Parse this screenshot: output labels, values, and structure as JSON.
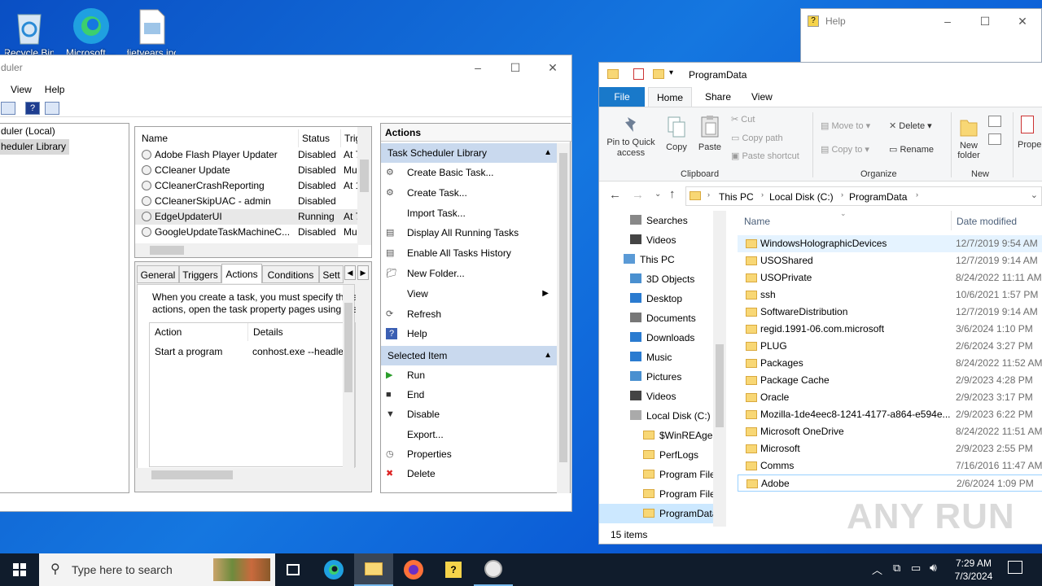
{
  "desktop": {
    "icons": [
      {
        "label": "Recycle Bin"
      },
      {
        "label": "Microsoft ..."
      },
      {
        "label": "dietyears.jpg"
      }
    ]
  },
  "task_scheduler": {
    "title": "duler",
    "menu": [
      "View",
      "Help"
    ],
    "tree": [
      "duler (Local)",
      "heduler Library"
    ],
    "task_list": {
      "columns": [
        "Name",
        "Status",
        "Trig"
      ],
      "rows": [
        {
          "name": "Adobe Flash Player Updater",
          "status": "Disabled",
          "trigger": "At 7"
        },
        {
          "name": "CCleaner Update",
          "status": "Disabled",
          "trigger": "Mu"
        },
        {
          "name": "CCleanerCrashReporting",
          "status": "Disabled",
          "trigger": "At 1"
        },
        {
          "name": "CCleanerSkipUAC - admin",
          "status": "Disabled",
          "trigger": ""
        },
        {
          "name": "EdgeUpdaterUI",
          "status": "Running",
          "trigger": "At 7"
        },
        {
          "name": "GoogleUpdateTaskMachineC...",
          "status": "Disabled",
          "trigger": "Mu"
        }
      ]
    },
    "detail_tabs": [
      "General",
      "Triggers",
      "Actions",
      "Conditions",
      "Sett"
    ],
    "active_tab": "Actions",
    "detail_text_1": "When you create a task, you must specify the ac",
    "detail_text_2": "actions, open the task property pages using the",
    "actions_table": {
      "columns": [
        "Action",
        "Details"
      ],
      "rows": [
        {
          "action": "Start a program",
          "details": "conhost.exe --headless"
        }
      ]
    },
    "actions_pane": {
      "header": "Actions",
      "section1": "Task Scheduler Library",
      "items1": [
        "Create Basic Task...",
        "Create Task...",
        "Import Task...",
        "Display All Running Tasks",
        "Enable All Tasks History",
        "New Folder...",
        "View",
        "Refresh",
        "Help"
      ],
      "section2": "Selected Item",
      "items2": [
        "Run",
        "End",
        "Disable",
        "Export...",
        "Properties",
        "Delete"
      ]
    }
  },
  "help_window": {
    "title": "Help"
  },
  "explorer": {
    "title": "ProgramData",
    "ribbon_tabs": [
      "File",
      "Home",
      "Share",
      "View"
    ],
    "active_tab": "Home",
    "clipboard": {
      "pin": "Pin to Quick access",
      "copy": "Copy",
      "paste": "Paste",
      "cut": "Cut",
      "copy_path": "Copy path",
      "paste_shortcut": "Paste shortcut",
      "group": "Clipboard"
    },
    "organize": {
      "move_to": "Move to",
      "copy_to": "Copy to",
      "delete": "Delete",
      "rename": "Rename",
      "group": "Organize"
    },
    "new": {
      "new_folder": "New folder",
      "group": "New"
    },
    "properties": "Prope",
    "breadcrumb": [
      "This PC",
      "Local Disk (C:)",
      "ProgramData"
    ],
    "nav_items": [
      "Searches",
      "Videos",
      "This PC",
      "3D Objects",
      "Desktop",
      "Documents",
      "Downloads",
      "Music",
      "Pictures",
      "Videos",
      "Local Disk (C:)",
      "$WinREAgent",
      "PerfLogs",
      "Program Files",
      "Program Files",
      "ProgramData"
    ],
    "columns": {
      "name": "Name",
      "date": "Date modified"
    },
    "files": [
      {
        "name": "WindowsHolographicDevices",
        "date": "12/7/2019 9:54 AM"
      },
      {
        "name": "USOShared",
        "date": "12/7/2019 9:14 AM"
      },
      {
        "name": "USOPrivate",
        "date": "8/24/2022 11:11 AM"
      },
      {
        "name": "ssh",
        "date": "10/6/2021 1:57 PM"
      },
      {
        "name": "SoftwareDistribution",
        "date": "12/7/2019 9:14 AM"
      },
      {
        "name": "regid.1991-06.com.microsoft",
        "date": "3/6/2024 1:10 PM"
      },
      {
        "name": "PLUG",
        "date": "2/6/2024 3:27 PM"
      },
      {
        "name": "Packages",
        "date": "8/24/2022 11:52 AM"
      },
      {
        "name": "Package Cache",
        "date": "2/9/2023 4:28 PM"
      },
      {
        "name": "Oracle",
        "date": "2/9/2023 3:17 PM"
      },
      {
        "name": "Mozilla-1de4eec8-1241-4177-a864-e594e...",
        "date": "2/9/2023 6:22 PM"
      },
      {
        "name": "Microsoft OneDrive",
        "date": "8/24/2022 11:51 AM"
      },
      {
        "name": "Microsoft",
        "date": "2/9/2023 2:55 PM"
      },
      {
        "name": "Comms",
        "date": "7/16/2016 11:47 AM"
      },
      {
        "name": "Adobe",
        "date": "2/6/2024 1:09 PM"
      }
    ],
    "status": "15 items"
  },
  "taskbar": {
    "search_placeholder": "Type here to search",
    "time": "7:29 AM",
    "date": "7/3/2024"
  },
  "watermark": "ANY RUN"
}
